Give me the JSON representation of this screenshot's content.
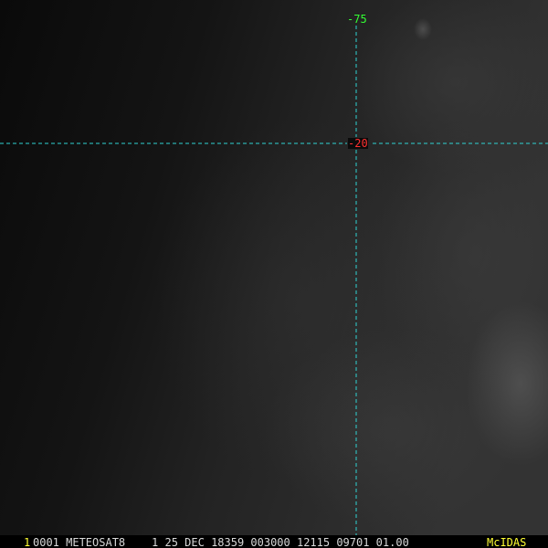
{
  "colors": {
    "background": "#0b0b0b",
    "grid_line": "#2fd3d3",
    "longitude_label": "#33ff33",
    "latitude_label": "#ff3030",
    "status_text": "#d8d8d8",
    "highlight_text": "#ffff33"
  },
  "overlay": {
    "longitude_label": "-75",
    "latitude_label": "-20"
  },
  "status_bar": {
    "frame_number": "1",
    "text": "0001 METEOSAT8    1 25 DEC 18359 003000 12115 09701 01.00",
    "brand": "McIDAS"
  }
}
